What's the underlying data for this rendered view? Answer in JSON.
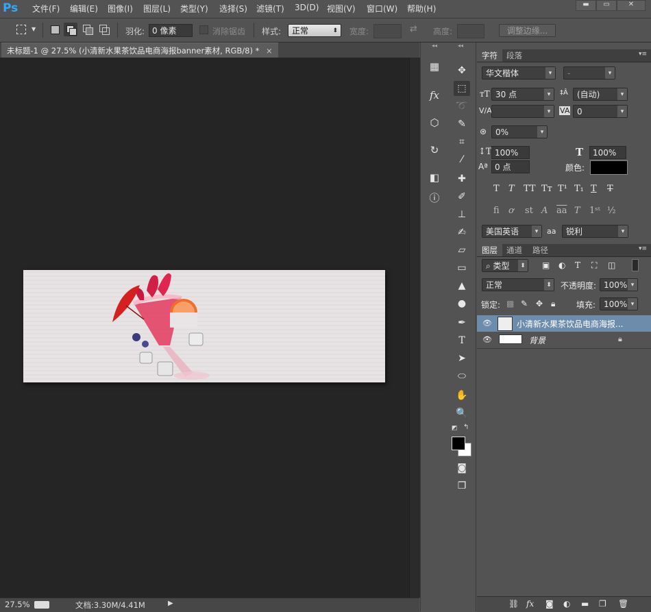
{
  "app": {
    "logo": "Ps"
  },
  "menu": [
    "文件(F)",
    "编辑(E)",
    "图像(I)",
    "图层(L)",
    "类型(Y)",
    "选择(S)",
    "滤镜(T)",
    "3D(D)",
    "视图(V)",
    "窗口(W)",
    "帮助(H)"
  ],
  "window_controls": {
    "minimize": "▬",
    "restore": "▭",
    "close": "✕"
  },
  "options": {
    "feather_label": "羽化:",
    "feather_value": "0 像素",
    "antialias_label": "消除锯齿",
    "style_label": "样式:",
    "style_value": "正常",
    "width_label": "宽度:",
    "height_label": "高度:",
    "refine_edge": "调整边缘..."
  },
  "document": {
    "tab_title": "未标题-1 @ 27.5% (小清新水果茶饮品电商海报banner素材, RGB/8) *",
    "tab_close": "×"
  },
  "status": {
    "zoom": "27.5%",
    "doc_info": "文档:3.30M/4.41M",
    "arrow": "▶"
  },
  "character_panel": {
    "tabs": [
      "字符",
      "段落"
    ],
    "font_family": "华文楷体",
    "font_style": "-",
    "font_size": "30 点",
    "leading": "(自动)",
    "kerning": "",
    "tracking": "0",
    "scale_proportion": "0%",
    "vertical_scale": "100%",
    "horizontal_scale": "100%",
    "baseline_shift": "0 点",
    "color_label": "颜色:",
    "language": "美国英语",
    "antialias_label": "aa",
    "antialias": "锐利"
  },
  "layers_panel": {
    "tabs": [
      "图层",
      "通道",
      "路径"
    ],
    "filter_kind": "类型",
    "blend_mode": "正常",
    "opacity_label": "不透明度:",
    "opacity": "100%",
    "lock_label": "锁定:",
    "fill_label": "填充:",
    "fill": "100%",
    "layers": [
      {
        "name": "小清新水果茶饮品电商海报...",
        "selected": true,
        "type": "smart-object"
      },
      {
        "name": "背景",
        "selected": false,
        "type": "background",
        "locked": true
      }
    ],
    "footer_icons": [
      "link-icon",
      "fx-icon",
      "mask-icon",
      "adjustment-icon",
      "group-icon",
      "new-layer-icon",
      "trash-icon"
    ]
  },
  "colors": {
    "accent_blue": "#31a8ff",
    "canvas_bg": "#252525",
    "panel_bg": "#535353",
    "selected_layer": "#6d8bab"
  }
}
